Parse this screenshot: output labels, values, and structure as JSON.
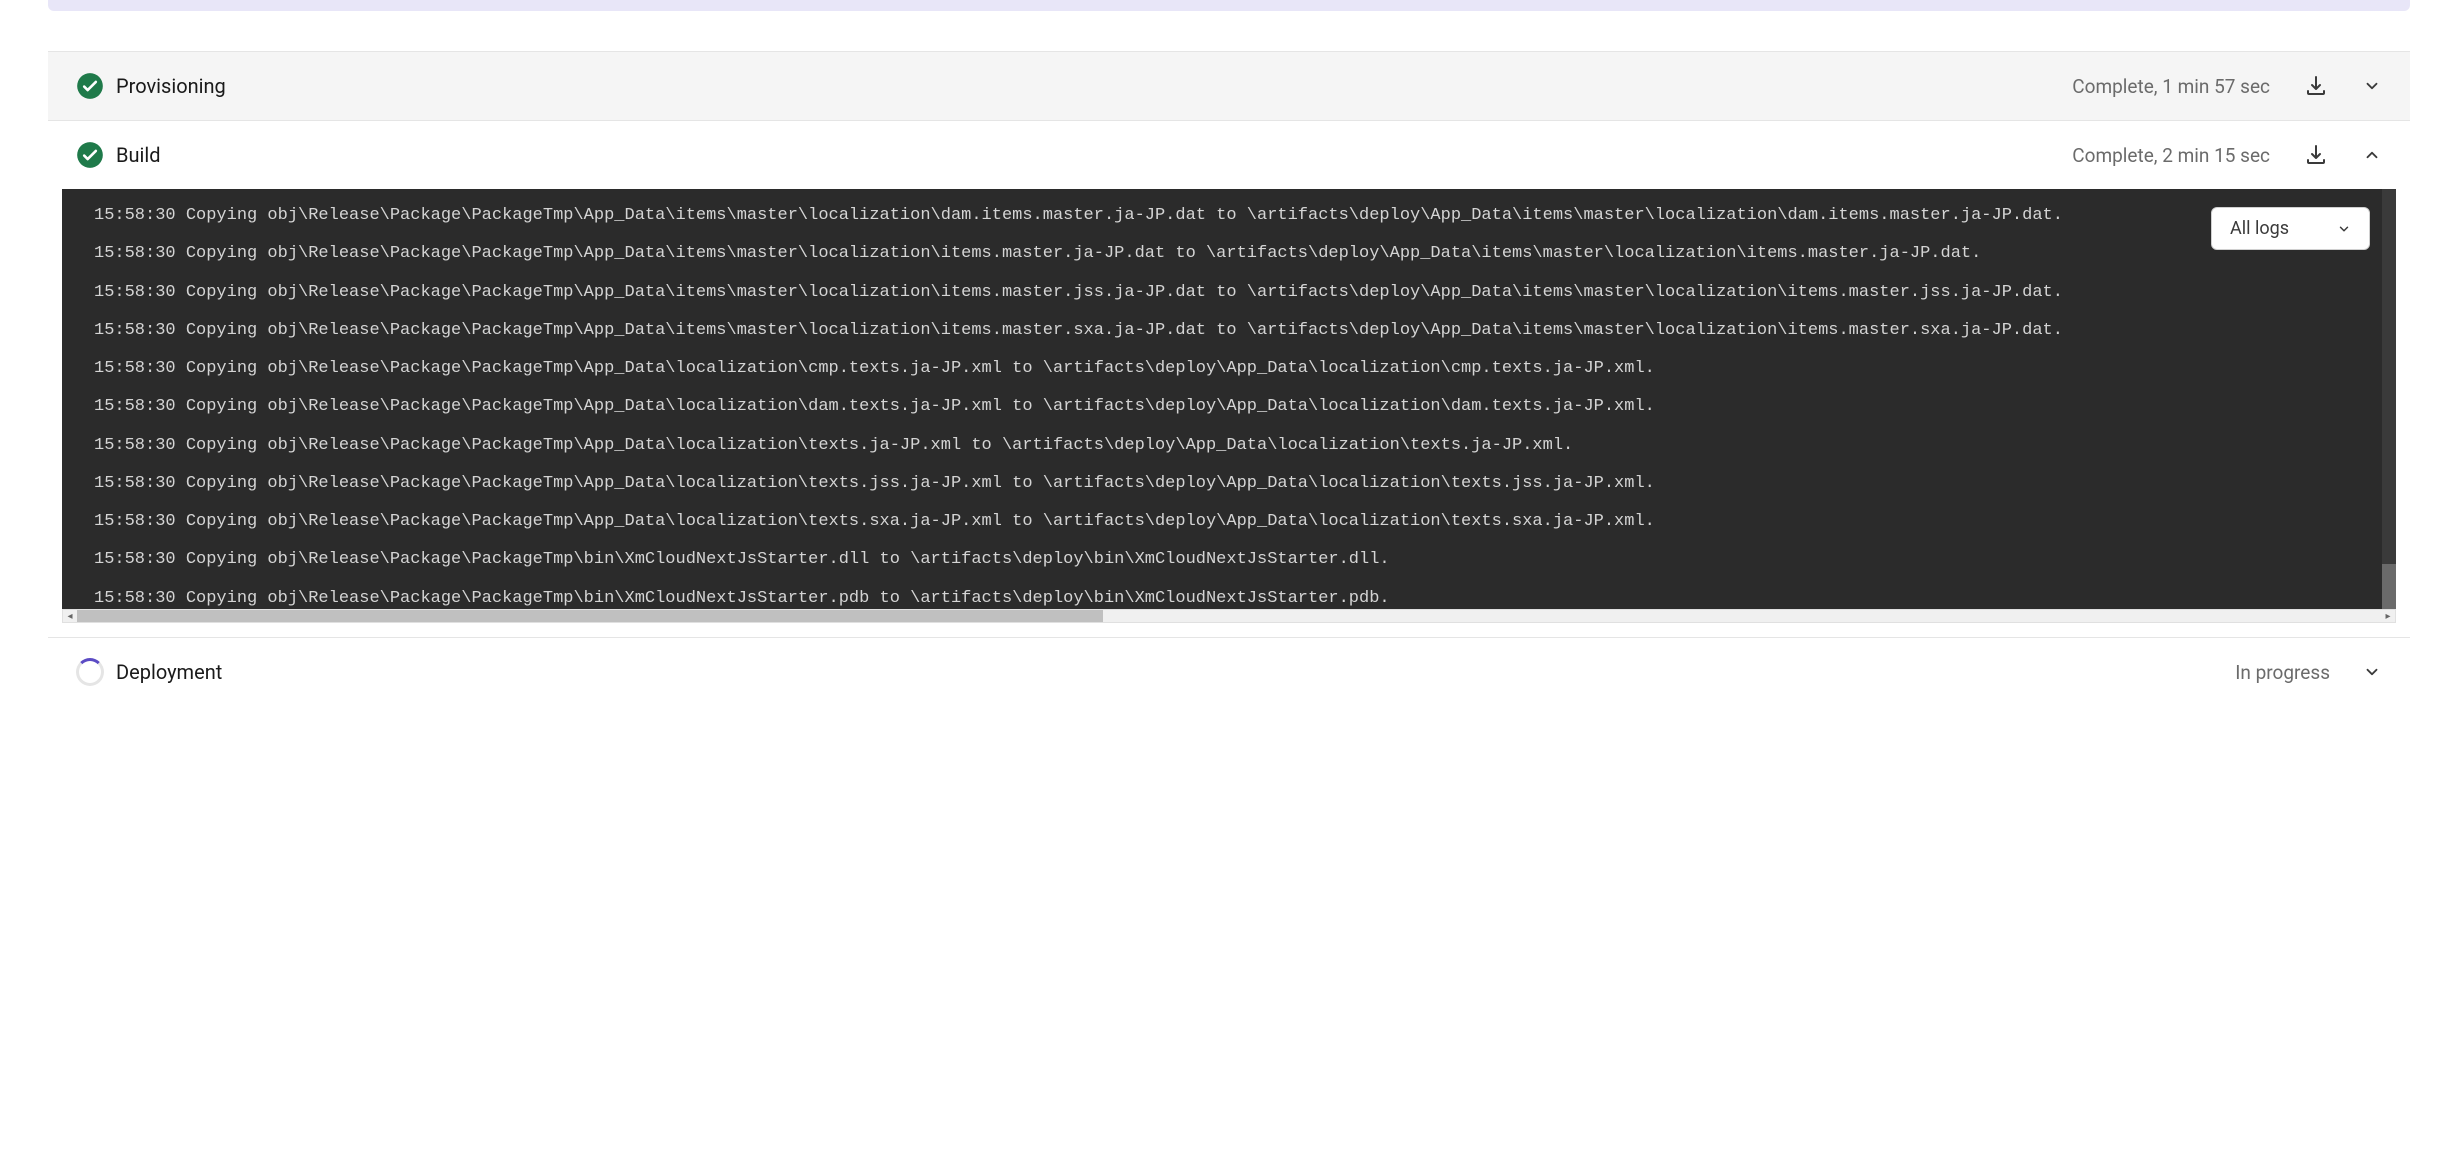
{
  "stages": {
    "provisioning": {
      "title": "Provisioning",
      "status": "Complete, 1 min 57 sec"
    },
    "build": {
      "title": "Build",
      "status": "Complete, 2 min 15 sec"
    },
    "deployment": {
      "title": "Deployment",
      "status": "In progress"
    }
  },
  "logFilter": {
    "selected": "All logs"
  },
  "buildLogLines": [
    "15:58:30 Copying obj\\Release\\Package\\PackageTmp\\App_Data\\items\\master\\localization\\dam.items.master.ja-JP.dat to \\artifacts\\deploy\\App_Data\\items\\master\\localization\\dam.items.master.ja-JP.dat.",
    "15:58:30 Copying obj\\Release\\Package\\PackageTmp\\App_Data\\items\\master\\localization\\items.master.ja-JP.dat to \\artifacts\\deploy\\App_Data\\items\\master\\localization\\items.master.ja-JP.dat.",
    "15:58:30 Copying obj\\Release\\Package\\PackageTmp\\App_Data\\items\\master\\localization\\items.master.jss.ja-JP.dat to \\artifacts\\deploy\\App_Data\\items\\master\\localization\\items.master.jss.ja-JP.dat.",
    "15:58:30 Copying obj\\Release\\Package\\PackageTmp\\App_Data\\items\\master\\localization\\items.master.sxa.ja-JP.dat to \\artifacts\\deploy\\App_Data\\items\\master\\localization\\items.master.sxa.ja-JP.dat.",
    "15:58:30 Copying obj\\Release\\Package\\PackageTmp\\App_Data\\localization\\cmp.texts.ja-JP.xml to \\artifacts\\deploy\\App_Data\\localization\\cmp.texts.ja-JP.xml.",
    "15:58:30 Copying obj\\Release\\Package\\PackageTmp\\App_Data\\localization\\dam.texts.ja-JP.xml to \\artifacts\\deploy\\App_Data\\localization\\dam.texts.ja-JP.xml.",
    "15:58:30 Copying obj\\Release\\Package\\PackageTmp\\App_Data\\localization\\texts.ja-JP.xml to \\artifacts\\deploy\\App_Data\\localization\\texts.ja-JP.xml.",
    "15:58:30 Copying obj\\Release\\Package\\PackageTmp\\App_Data\\localization\\texts.jss.ja-JP.xml to \\artifacts\\deploy\\App_Data\\localization\\texts.jss.ja-JP.xml.",
    "15:58:30 Copying obj\\Release\\Package\\PackageTmp\\App_Data\\localization\\texts.sxa.ja-JP.xml to \\artifacts\\deploy\\App_Data\\localization\\texts.sxa.ja-JP.xml.",
    "15:58:30 Copying obj\\Release\\Package\\PackageTmp\\bin\\XmCloudNextJsStarter.dll to \\artifacts\\deploy\\bin\\XmCloudNextJsStarter.dll.",
    "15:58:30 Copying obj\\Release\\Package\\PackageTmp\\bin\\XmCloudNextJsStarter.pdb to \\artifacts\\deploy\\bin\\XmCloudNextJsStarter.pdb."
  ]
}
